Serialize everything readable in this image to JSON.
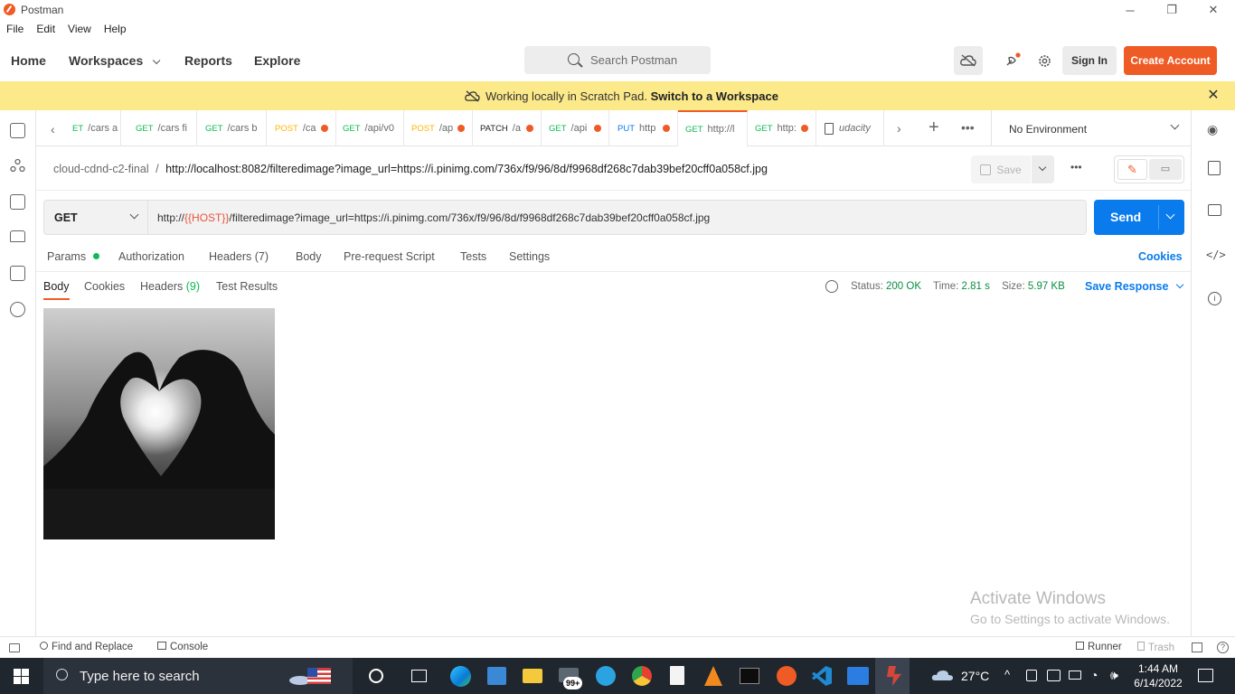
{
  "window": {
    "title": "Postman",
    "controls": {
      "minimize": "─",
      "restore": "❐",
      "close": "✕"
    }
  },
  "menu": [
    "File",
    "Edit",
    "View",
    "Help"
  ],
  "header": {
    "nav": {
      "home": "Home",
      "workspaces": "Workspaces",
      "reports": "Reports",
      "explore": "Explore"
    },
    "search_placeholder": "Search Postman",
    "sign_in": "Sign In",
    "create_account": "Create Account"
  },
  "banner": {
    "text": "Working locally in Scratch Pad.",
    "link": "Switch to a Workspace"
  },
  "tabs": [
    {
      "method": "ET",
      "path": "/cars a",
      "method_class": "m-get",
      "dirty": false
    },
    {
      "method": "GET",
      "path": "/cars fi",
      "method_class": "m-get",
      "dirty": false
    },
    {
      "method": "GET",
      "path": "/cars b",
      "method_class": "m-get",
      "dirty": false
    },
    {
      "method": "POST",
      "path": "/ca",
      "method_class": "m-post",
      "dirty": true
    },
    {
      "method": "GET",
      "path": "/api/v0",
      "method_class": "m-get",
      "dirty": false
    },
    {
      "method": "POST",
      "path": "/ap",
      "method_class": "m-post",
      "dirty": true
    },
    {
      "method": "PATCH",
      "path": "/a",
      "method_class": "m-patch",
      "dirty": true
    },
    {
      "method": "GET",
      "path": "/api",
      "method_class": "m-get",
      "dirty": true
    },
    {
      "method": "PUT",
      "path": "http",
      "method_class": "m-put",
      "dirty": true
    },
    {
      "method": "GET",
      "path": "http://l",
      "method_class": "m-get",
      "dirty": false,
      "active": true
    },
    {
      "method": "GET",
      "path": "http:",
      "method_class": "m-get",
      "dirty": true
    },
    {
      "method": "",
      "path": "udacity",
      "method_class": "",
      "dirty": false,
      "doc": true
    }
  ],
  "environment": "No Environment",
  "breadcrumb": {
    "collection": "cloud-cdnd-c2-final",
    "separator": "/",
    "request": "http://localhost:8082/filteredimage?image_url=https://i.pinimg.com/736x/f9/96/8d/f9968df268c7dab39bef20cff0a058cf.jpg",
    "save": "Save"
  },
  "request": {
    "method": "GET",
    "url_prefix": "http://",
    "url_variable": "{{HOST}}",
    "url_suffix": "/filteredimage?image_url=https://i.pinimg.com/736x/f9/96/8d/f9968df268c7dab39bef20cff0a058cf.jpg",
    "send": "Send"
  },
  "request_tabs": {
    "params": "Params",
    "authorization": "Authorization",
    "headers": "Headers",
    "headers_count": "(7)",
    "body": "Body",
    "pre_request": "Pre-request Script",
    "tests": "Tests",
    "settings": "Settings",
    "cookies": "Cookies"
  },
  "response_tabs": {
    "body": "Body",
    "cookies": "Cookies",
    "headers": "Headers",
    "headers_count": "(9)",
    "test_results": "Test Results"
  },
  "response_meta": {
    "status_label": "Status:",
    "status_value": "200 OK",
    "time_label": "Time:",
    "time_value": "2.81 s",
    "size_label": "Size:",
    "size_value": "5.97 KB",
    "save_response": "Save Response"
  },
  "watermark": {
    "line1": "Activate Windows",
    "line2": "Go to Settings to activate Windows."
  },
  "footer": {
    "find_replace": "Find and Replace",
    "console": "Console",
    "runner": "Runner",
    "trash": "Trash"
  },
  "taskbar": {
    "search_placeholder": "Type here to search",
    "badge": "99+",
    "temperature": "27°C",
    "time": "1:44 AM",
    "date": "6/14/2022"
  },
  "colors": {
    "accent": "#ef5b25",
    "send": "#097bed",
    "banner": "#fce98a",
    "status_ok": "#0a8f41"
  }
}
